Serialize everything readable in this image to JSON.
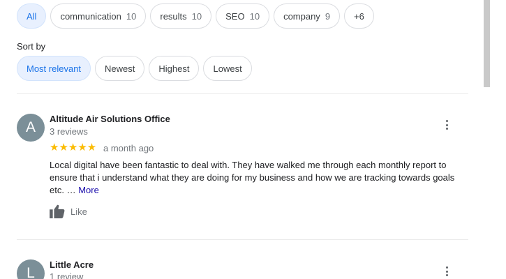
{
  "filters": {
    "chips": [
      {
        "label": "All",
        "count": "",
        "selected": true
      },
      {
        "label": "communication",
        "count": "10"
      },
      {
        "label": "results",
        "count": "10"
      },
      {
        "label": "SEO",
        "count": "10"
      },
      {
        "label": "company",
        "count": "9"
      },
      {
        "label": "+6",
        "count": ""
      }
    ]
  },
  "sort": {
    "label": "Sort by",
    "options": [
      {
        "label": "Most relevant",
        "selected": true
      },
      {
        "label": "Newest"
      },
      {
        "label": "Highest"
      },
      {
        "label": "Lowest"
      }
    ]
  },
  "reviews": [
    {
      "avatar_letter": "A",
      "name": "Altitude Air Solutions Office",
      "review_count": "3 reviews",
      "rating": 5,
      "stars": "★★★★★",
      "date": "a month ago",
      "text": "Local digital have been fantastic to deal with. They have walked me through each monthly report to ensure that i understand what they are doing for my business and how we are tracking towards goals etc. …",
      "more_label": "More",
      "like_label": "Like"
    },
    {
      "avatar_letter": "L",
      "name": "Little Acre",
      "review_count": "1 review"
    }
  ],
  "colors": {
    "accent": "#1a73e8",
    "chip_selected_bg": "#e8f0fe",
    "star": "#fbbc04",
    "avatar_bg": "#7b8f98"
  }
}
